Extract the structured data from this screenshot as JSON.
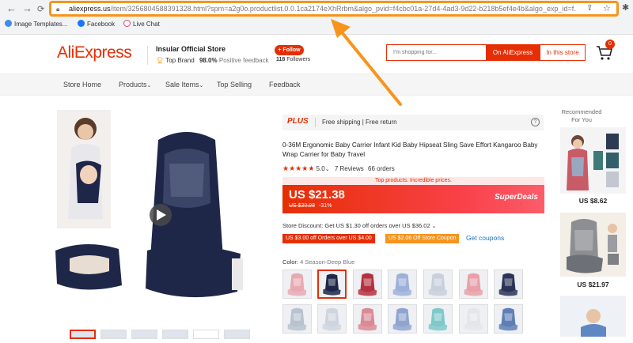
{
  "browser": {
    "back": "←",
    "forward": "→",
    "reload": "C",
    "url_host": "aliexpress.us",
    "url_rest": "/item/3256804588391328.html?spm=a2g0o.productlist.0.0.1ca2174eXhRrbm&algo_pvid=f4cbc01a-27d4-4ad3-9d22-b218b5ef4e4b&algo_exp_id=f...",
    "bookmarks": [
      "Image Templates...",
      "Facebook",
      "Live Chat"
    ]
  },
  "header": {
    "logo": "AliExpress",
    "store_name": "Insular Official Store",
    "store_badge": "Top Brand",
    "feedback_value": "98.0%",
    "feedback_label": "Positive feedback",
    "follow_label": "+ Follow",
    "followers_count": "118",
    "followers_label": "Followers",
    "search_placeholder": "I'm shopping for...",
    "search_ali": "On AliExpress",
    "search_store": "In this store",
    "cart_count": "0"
  },
  "nav": [
    "Store Home",
    "Products",
    "Sale Items",
    "Top Selling",
    "Feedback"
  ],
  "product": {
    "plus_label": "PLUS",
    "shipping": "Free shipping | Free return",
    "title": "0-36M Ergonomic Baby Carrier Infant Kid Baby Hipseat Sling Save Effort Kangaroo Baby Wrap Carrier for Baby Travel",
    "rating": "5.0",
    "reviews": "7 Reviews",
    "orders": "66 orders",
    "top_products": "Top products. Incredible prices.",
    "price": "US $21.38",
    "old_price": "US $30.98",
    "discount": "-31%",
    "superdeals": "SuperDeals",
    "store_discount": "Store Discount: Get US $1.30 off orders over US $36.02",
    "coupon1": "US $3.00 off Orders over US $4.00",
    "coupon2": "US $2.06 Off Store Coupon",
    "get_coupons": "Get coupons",
    "color_label": "Color:",
    "color_value": "4 Season-Deep Blue"
  },
  "recommended": {
    "title": "Recommended For You",
    "prices": [
      "US $8.62",
      "US $21.97"
    ]
  },
  "colors": {
    "accent": "#e62e04",
    "arrow": "#f7941d",
    "coupon_orange": "#f7941d",
    "link_blue": "#1a73b8"
  },
  "swatches": [
    {
      "main": "#e8a9b3"
    },
    {
      "main": "#1f2749"
    },
    {
      "main": "#b5313f"
    },
    {
      "main": "#9db1d8"
    },
    {
      "main": "#c9d0dc"
    },
    {
      "main": "#e9a0a8"
    },
    {
      "main": "#2b3357"
    },
    {
      "main": "#b9c2cf"
    },
    {
      "main": "#cfd5de"
    },
    {
      "main": "#d98b93"
    },
    {
      "main": "#8fa5cf"
    },
    {
      "main": "#7fc9c9"
    },
    {
      "main": "#e4e6ea"
    },
    {
      "main": "#5e7fb5"
    }
  ]
}
